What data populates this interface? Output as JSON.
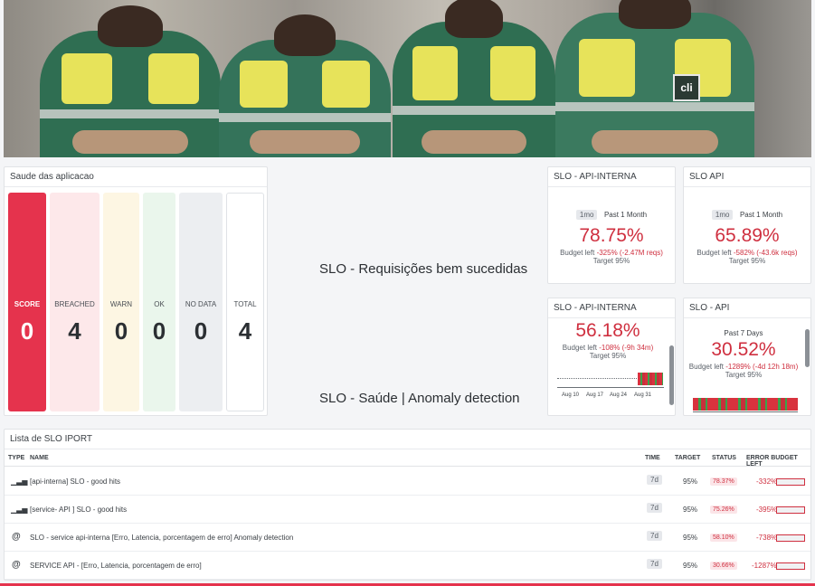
{
  "saude": {
    "title": "Saude das aplicacao",
    "tiles": [
      {
        "label": "SCORE",
        "value": "0"
      },
      {
        "label": "BREACHED",
        "value": "4"
      },
      {
        "label": "WARN",
        "value": "0"
      },
      {
        "label": "OK",
        "value": "0"
      },
      {
        "label": "NO DATA",
        "value": "0"
      },
      {
        "label": "TOTAL",
        "value": "4"
      }
    ]
  },
  "center": {
    "req_text": "SLO - Requisições bem sucedidas",
    "anomaly_text": "SLO - Saúde | Anomaly detection"
  },
  "slo_cards": [
    {
      "title": "SLO - API-INTERNA",
      "pill": "1mo",
      "period": "Past 1 Month",
      "value": "78.75%",
      "budget_prefix": "Budget left ",
      "budget": "-325% (-2.47M reqs)",
      "target": "Target 95%"
    },
    {
      "title": "SLO API",
      "pill": "1mo",
      "period": "Past 1 Month",
      "value": "65.89%",
      "budget_prefix": "Budget left ",
      "budget": "-582% (-43.6k reqs)",
      "target": "Target 95%"
    },
    {
      "title": "SLO - API-INTERNA",
      "value": "56.18%",
      "budget_prefix": "Budget left ",
      "budget": "-108% (-9h 34m)",
      "target": "Target 95%",
      "ticks": [
        "Aug 10",
        "Aug 17",
        "Aug 24",
        "Aug 31"
      ]
    },
    {
      "title": "SLO - API",
      "period": "Past 7 Days",
      "value": "30.52%",
      "budget_prefix": "Budget left ",
      "budget": "-1289% (-4d 12h 18m)",
      "target": "Target 95%"
    }
  ],
  "table": {
    "title": "Lista de SLO IPORT",
    "headers": {
      "type": "TYPE",
      "name": "NAME",
      "time": "TIME",
      "target": "TARGET",
      "status": "STATUS",
      "error": "ERROR BUDGET LEFT"
    },
    "rows": [
      {
        "icon": "bar-chart-icon",
        "name": "[api-interna] SLO - good hits",
        "time": "7d",
        "target": "95%",
        "status": "78.37%",
        "error": "-332%"
      },
      {
        "icon": "bar-chart-icon",
        "name": "[service- API ] SLO - good hits",
        "time": "7d",
        "target": "95%",
        "status": "75.26%",
        "error": "-395%"
      },
      {
        "icon": "monitor-icon",
        "name": "SLO - service api-interna [Erro, Latencia, porcentagem de erro] Anomaly detection",
        "time": "7d",
        "target": "95%",
        "status": "58.10%",
        "error": "-738%"
      },
      {
        "icon": "monitor-icon",
        "name": "SERVICE API - [Erro, Latencia, porcentagem de erro]",
        "time": "7d",
        "target": "95%",
        "status": "30.66%",
        "error": "-1287%"
      }
    ]
  },
  "colors": {
    "accent_red": "#e5334d",
    "value_red": "#cf2f3f",
    "bar_green": "#3aa34a"
  }
}
